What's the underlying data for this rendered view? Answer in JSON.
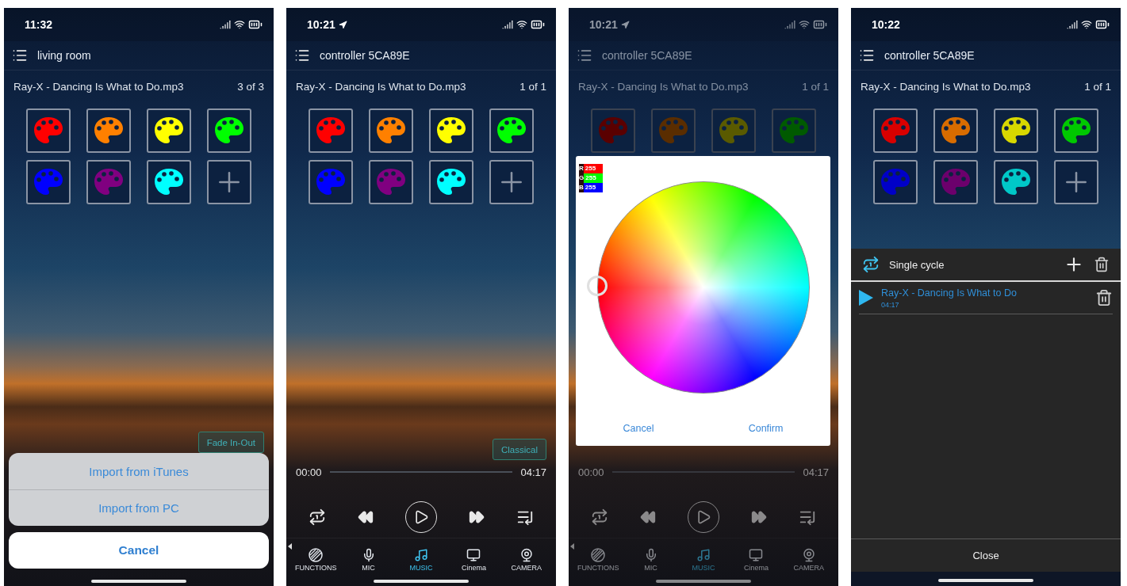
{
  "phones": [
    {
      "status": {
        "time": "11:32",
        "location": false
      },
      "title": "living room",
      "track": "Ray-X - Dancing Is What to Do.mp3",
      "count": "3 of 3",
      "dimmed": false,
      "swatches": [
        {
          "color": "#ff0000"
        },
        {
          "color": "#ff8000"
        },
        {
          "color": "#ffff00"
        },
        {
          "color": "#00ff00"
        },
        {
          "color": "#0000ff"
        },
        {
          "color": "#800080"
        },
        {
          "color": "#00ffff"
        }
      ],
      "mode_button": "Fade In-Out",
      "action_sheet": {
        "actions": [
          "Import from iTunes",
          "Import from PC"
        ],
        "cancel": "Cancel"
      }
    },
    {
      "status": {
        "time": "10:21",
        "location": true
      },
      "title": "controller 5CA89E",
      "track": "Ray-X - Dancing Is What to Do.mp3",
      "count": "1 of 1",
      "dimmed": false,
      "swatches": [
        {
          "color": "#ff0000"
        },
        {
          "color": "#ff8000"
        },
        {
          "color": "#ffff00"
        },
        {
          "color": "#00ff00"
        },
        {
          "color": "#0000ff"
        },
        {
          "color": "#800080"
        },
        {
          "color": "#00ffff"
        }
      ],
      "mode_button": "Classical",
      "player": {
        "elapsed": "00:00",
        "duration": "04:17",
        "nav": [
          {
            "label": "FUNCTIONS",
            "selected": false
          },
          {
            "label": "MIC",
            "selected": false
          },
          {
            "label": "MUSIC",
            "selected": true
          },
          {
            "label": "Cinema",
            "selected": false
          },
          {
            "label": "CAMERA",
            "selected": false
          }
        ]
      }
    },
    {
      "status": {
        "time": "10:21",
        "location": true
      },
      "title": "controller 5CA89E",
      "track": "Ray-X - Dancing Is What to Do.mp3",
      "count": "1 of 1",
      "dimmed": true,
      "swatches": [
        {
          "color": "#5a0000"
        },
        {
          "color": "#5a2d00"
        },
        {
          "color": "#5a5a00"
        },
        {
          "color": "#005a00"
        }
      ],
      "color_picker": {
        "readouts": [
          {
            "channel": "R",
            "value": "255",
            "color": "#ff0000"
          },
          {
            "channel": "G",
            "value": "255",
            "color": "#00ff00"
          },
          {
            "channel": "B",
            "value": "255",
            "color": "#0000ff"
          }
        ],
        "buttons": [
          "Cancel",
          "Confirm"
        ]
      },
      "player": {
        "elapsed": "00:00",
        "duration": "04:17",
        "nav": [
          {
            "label": "FUNCTIONS",
            "selected": false
          },
          {
            "label": "MIC",
            "selected": false
          },
          {
            "label": "MUSIC",
            "selected": true
          },
          {
            "label": "Cinema",
            "selected": false
          },
          {
            "label": "CAMERA",
            "selected": false
          }
        ]
      }
    },
    {
      "status": {
        "time": "10:22",
        "location": false
      },
      "title": "controller 5CA89E",
      "track": "Ray-X - Dancing Is What to Do.mp3",
      "count": "1 of 1",
      "dimmed": false,
      "swatches": [
        {
          "color": "#d80000"
        },
        {
          "color": "#d86c00"
        },
        {
          "color": "#d8d800"
        },
        {
          "color": "#00c800"
        },
        {
          "color": "#0000c8"
        },
        {
          "color": "#6c006c"
        },
        {
          "color": "#00c8c8"
        }
      ],
      "playlist": {
        "mode": "Single cycle",
        "items": [
          {
            "title": "Ray-X - Dancing Is What to Do",
            "duration": "04:17",
            "playing": true
          }
        ],
        "close": "Close"
      }
    }
  ]
}
